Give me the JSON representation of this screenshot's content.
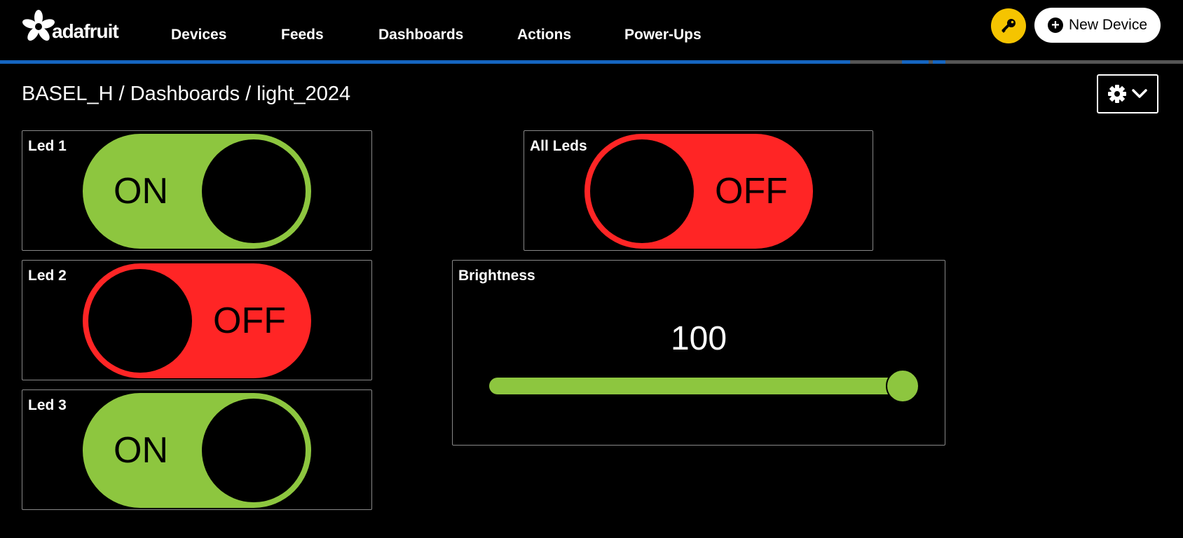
{
  "header": {
    "logo_text": "adafruit",
    "nav": [
      "Devices",
      "Feeds",
      "Dashboards",
      "Actions",
      "Power-Ups"
    ],
    "new_device_label": "New Device",
    "key_icon": "key-icon"
  },
  "breadcrumb": "BASEL_H / Dashboards / light_2024",
  "settings_icon": "gear-icon",
  "blocks": {
    "led1": {
      "title": "Led 1",
      "state": "ON",
      "color": "#8dc63f"
    },
    "led2": {
      "title": "Led 2",
      "state": "OFF",
      "color": "#ff2525"
    },
    "led3": {
      "title": "Led 3",
      "state": "ON",
      "color": "#8dc63f"
    },
    "all_leds": {
      "title": "All Leds",
      "state": "OFF",
      "color": "#ff2525"
    },
    "brightness": {
      "title": "Brightness",
      "value": "100",
      "min": 0,
      "max": 100
    }
  },
  "colors": {
    "accent_blue": "#1565c0",
    "key_yellow": "#f5c400"
  }
}
